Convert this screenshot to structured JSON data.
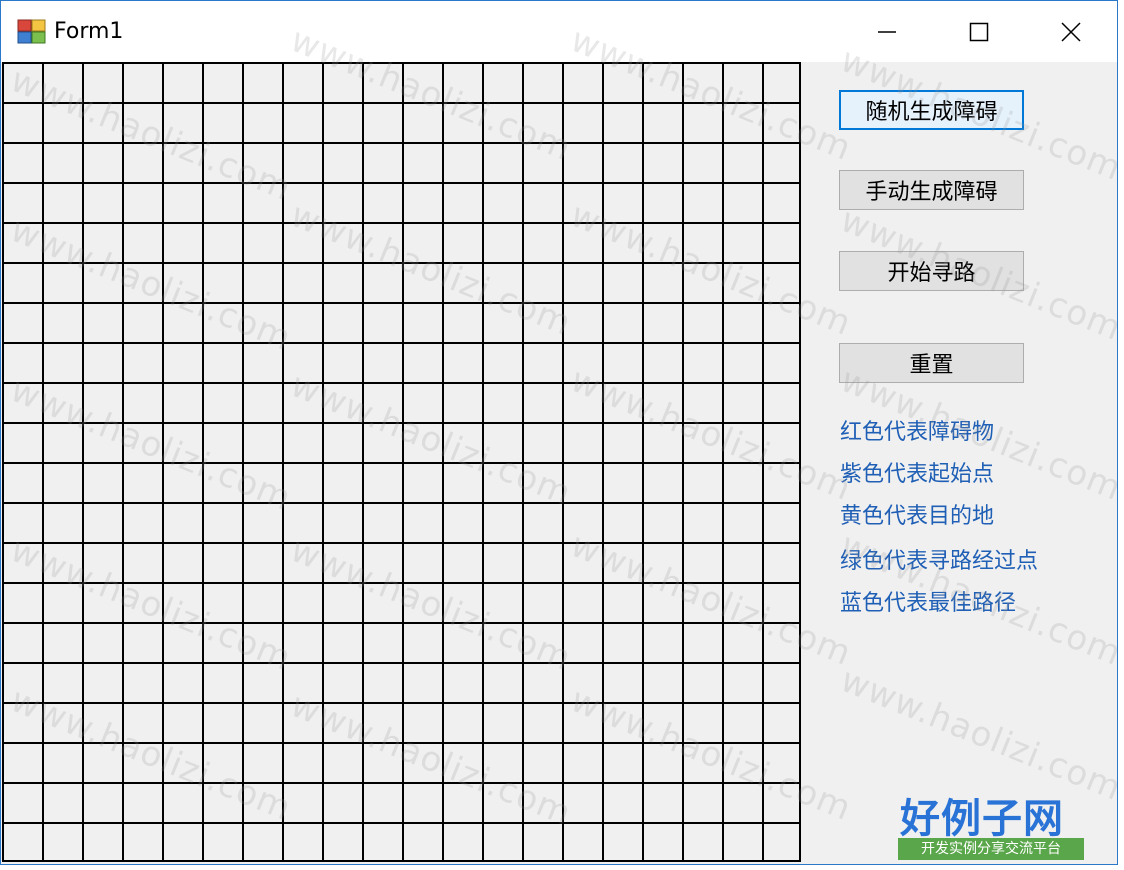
{
  "window": {
    "title": "Form1",
    "icon": "form-app-icon",
    "controls": {
      "minimize": "minimize-icon",
      "maximize": "maximize-icon",
      "close": "close-icon"
    }
  },
  "grid": {
    "columns": 20,
    "rows": 20,
    "line_color": "#000000",
    "cell_color": "#f0f0f0"
  },
  "buttons": {
    "random_obstacles": "随机生成障碍",
    "manual_obstacles": "手动生成障碍",
    "start_pathfinding": "开始寻路",
    "reset": "重置"
  },
  "legend": [
    "红色代表障碍物",
    "紫色代表起始点",
    "黄色代表目的地",
    "绿色代表寻路经过点",
    "蓝色代表最佳路径"
  ],
  "watermark": "www.haolizi.com",
  "logo": {
    "main": "好例子网",
    "sub": "开发实例分享交流平台"
  },
  "colors": {
    "accent": "#0078d7",
    "legend_text": "#1f5fb5",
    "logo_blue": "#2a73d6",
    "logo_green": "#5aa64a"
  }
}
